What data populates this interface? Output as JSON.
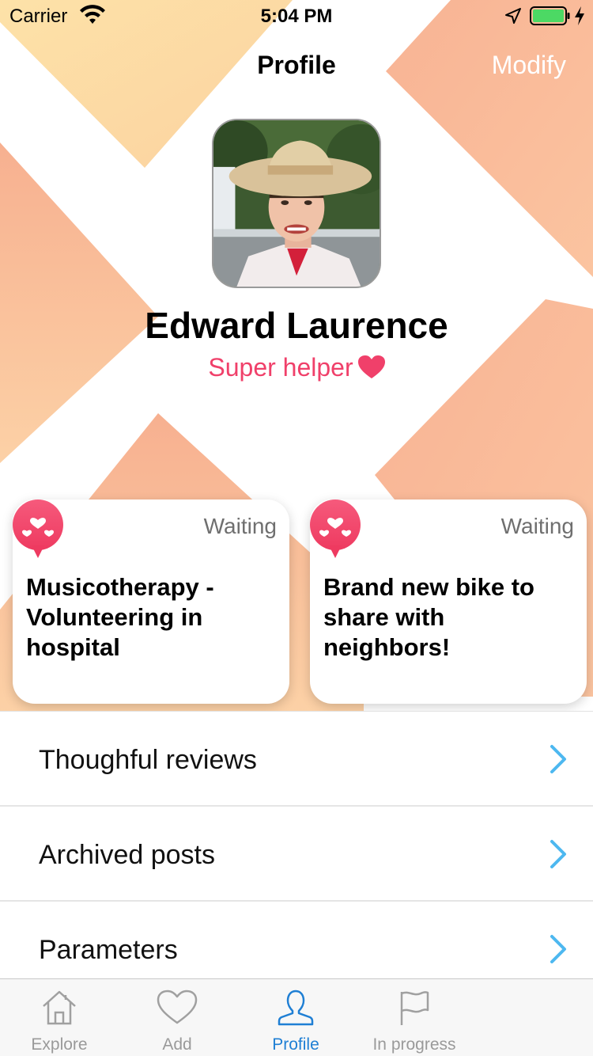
{
  "status_bar": {
    "carrier": "Carrier",
    "time": "5:04 PM",
    "icons": [
      "wifi-icon",
      "location-icon",
      "battery-icon",
      "charging-icon"
    ]
  },
  "nav": {
    "title": "Profile",
    "modify_label": "Modify"
  },
  "profile": {
    "name": "Edward Laurence",
    "badge": "Super helper",
    "badge_icon": "heart-icon"
  },
  "cards": [
    {
      "status": "Waiting",
      "title": "Musicotherapy - Volunteering in hospital",
      "icon": "hearts-bubble-icon"
    },
    {
      "status": "Waiting",
      "title": "Brand new bike to share with neighbors!",
      "icon": "hearts-bubble-icon"
    }
  ],
  "menu": [
    {
      "label": "Thoughful reviews",
      "icon": "chevron-right-icon"
    },
    {
      "label": "Archived posts",
      "icon": "chevron-right-icon"
    },
    {
      "label": "Parameters",
      "icon": "chevron-right-icon"
    }
  ],
  "tabs": [
    {
      "label": "Explore",
      "icon": "home-icon",
      "active": false
    },
    {
      "label": "Add",
      "icon": "heart-outline-icon",
      "active": false
    },
    {
      "label": "Profile",
      "icon": "person-icon",
      "active": true
    },
    {
      "label": "In progress",
      "icon": "flag-icon",
      "active": false
    }
  ],
  "colors": {
    "accent_pink": "#f0406a",
    "tab_active_blue": "#1f7fd4",
    "chevron_blue": "#4db8f0",
    "bg_peach": "#f9b995",
    "bg_yellow": "#fde2a8"
  }
}
